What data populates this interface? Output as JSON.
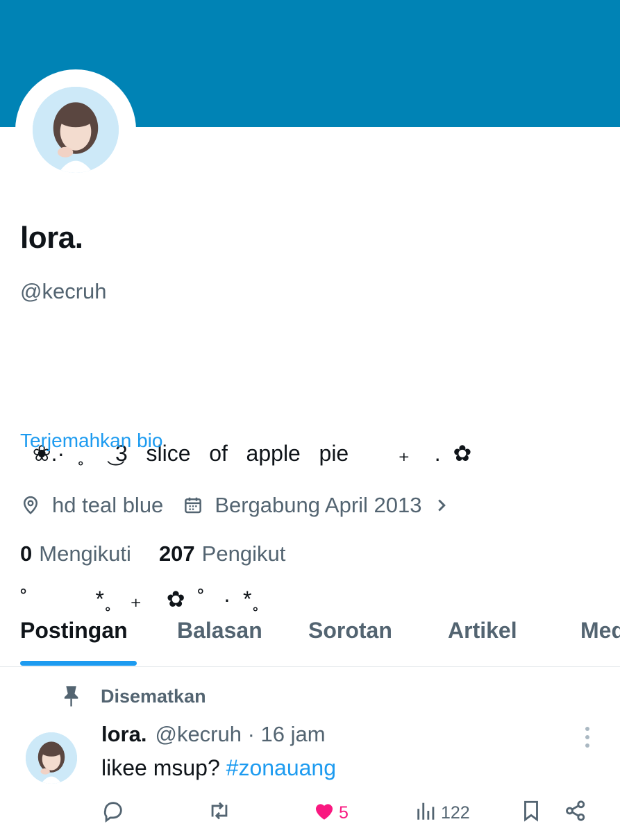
{
  "profile": {
    "display_name": "lora.",
    "handle": "@kecruh",
    "bio_line1": "  ❀.·  ˳    ͜ 3   slice   of   apple   pie        ₊    .  ✿",
    "bio_line2": "˚           *˳   ₊    ✿  ˚   ·  *˳",
    "translate_label": "Terjemahkan bio",
    "location": "hd teal blue",
    "joined": "Bergabung April 2013",
    "following_count": "0",
    "following_label": "Mengikuti",
    "followers_count": "207",
    "followers_label": "Pengikut",
    "banner_color": "#0083b5"
  },
  "tabs": [
    {
      "label": "Postingan",
      "active": true
    },
    {
      "label": "Balasan",
      "active": false
    },
    {
      "label": "Sorotan",
      "active": false
    },
    {
      "label": "Artikel",
      "active": false
    },
    {
      "label": "Media",
      "active": false
    }
  ],
  "pinned_tweet": {
    "pinned_label": "Disematkan",
    "author_name": "lora.",
    "author_handle": "@kecruh",
    "time": "· 16 jam",
    "text": "likee msup? ",
    "hashtag": "#zonauang",
    "likes": "5",
    "views": "122",
    "liked": true
  },
  "icons": [
    "location-pin-icon",
    "calendar-icon",
    "chevron-right-icon",
    "pin-icon",
    "more-icon",
    "reply-icon",
    "retweet-icon",
    "heart-icon",
    "views-icon",
    "bookmark-icon",
    "share-icon"
  ],
  "colors": {
    "accent": "#1d9bf0",
    "like": "#f91880",
    "muted": "#536471"
  }
}
